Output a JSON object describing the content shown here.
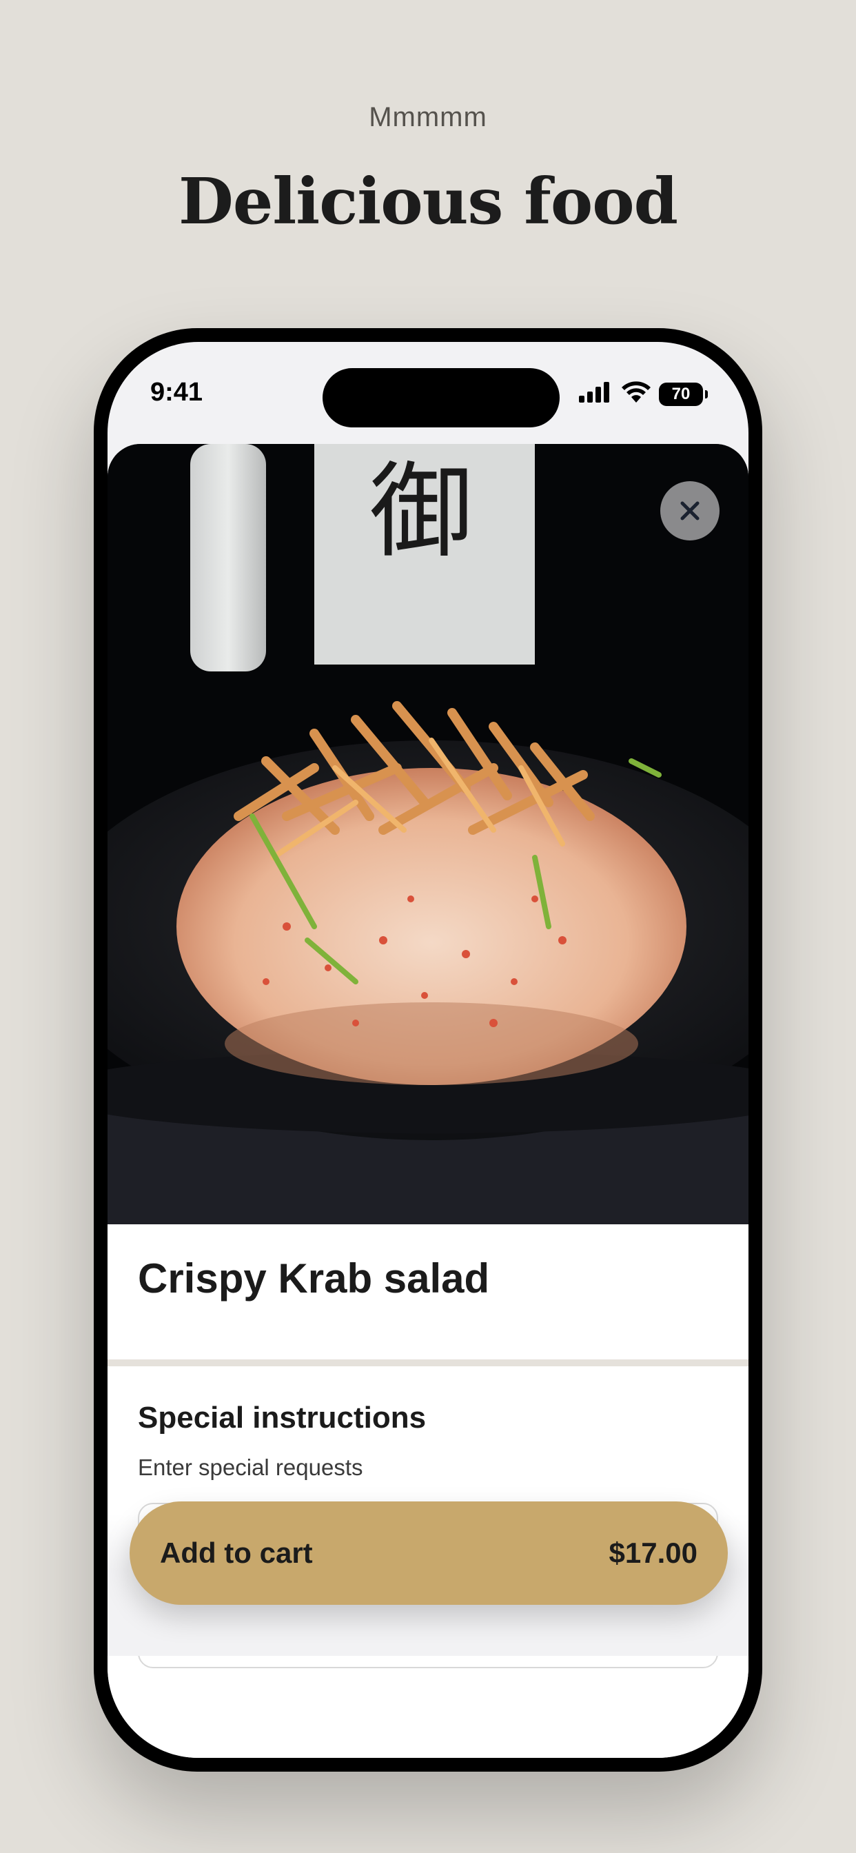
{
  "page": {
    "eyebrow": "Mmmmm",
    "headline": "Delicious food"
  },
  "status_bar": {
    "time": "9:41",
    "battery": "70",
    "icons": [
      "cellular-signal-icon",
      "wifi-icon",
      "battery-icon"
    ]
  },
  "item": {
    "photo_icon": "food-photo",
    "close_icon": "close-icon",
    "title": "Crispy Krab salad"
  },
  "special_instructions": {
    "title": "Special instructions",
    "subtitle": "Enter special requests",
    "placeholder": "Enter special requests",
    "value": ""
  },
  "cart": {
    "label": "Add to cart",
    "price": "$17.00"
  },
  "colors": {
    "background": "#e2dfd9",
    "accent": "#c8a86c",
    "text": "#1b1b1b"
  }
}
